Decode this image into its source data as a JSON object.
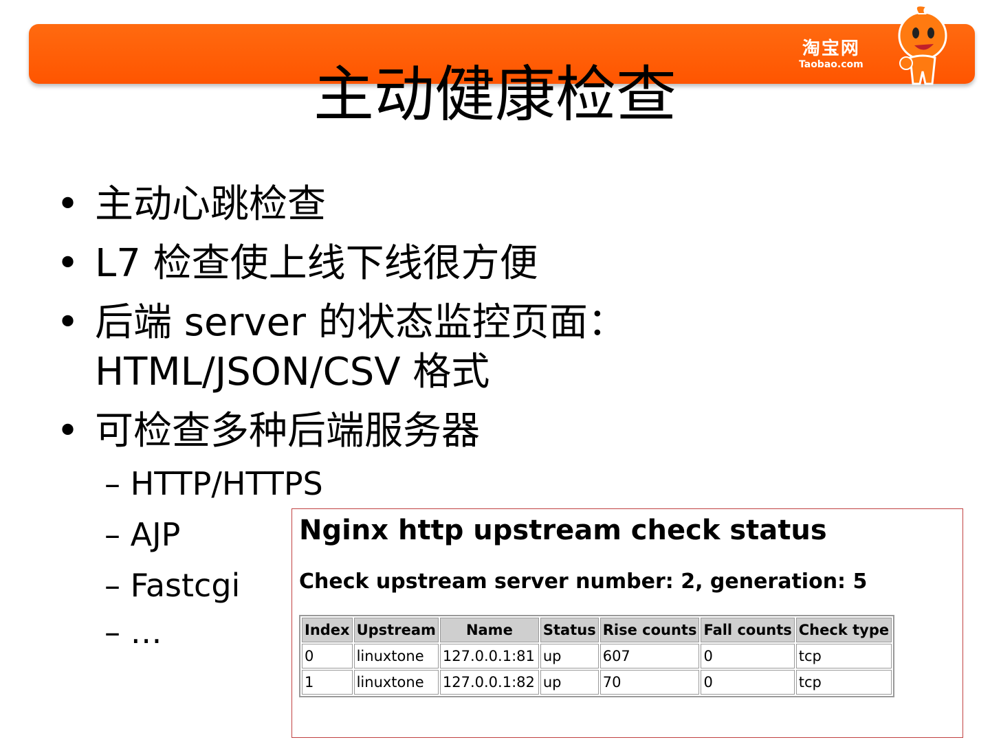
{
  "logo": {
    "cn": "淘宝网",
    "en": "Taobao.com"
  },
  "title": "主动健康检查",
  "bullets": [
    "主动心跳检查",
    "L7 检查使上线下线很方便",
    "后端 server 的状态监控页面： HTML/JSON/CSV 格式",
    "可检查多种后端服务器"
  ],
  "sub_items": [
    "– HTTP/HTTPS",
    "– AJP",
    "– Fastcgi",
    "– …"
  ],
  "status_page": {
    "heading": "Nginx http upstream check status",
    "summary": "Check upstream server number: 2, generation: 5",
    "columns": [
      "Index",
      "Upstream",
      "Name",
      "Status",
      "Rise counts",
      "Fall counts",
      "Check type"
    ],
    "rows": [
      [
        "0",
        "linuxtone",
        "127.0.0.1:81",
        "up",
        "607",
        "0",
        "tcp"
      ],
      [
        "1",
        "linuxtone",
        "127.0.0.1:82",
        "up",
        "70",
        "0",
        "tcp"
      ]
    ]
  }
}
